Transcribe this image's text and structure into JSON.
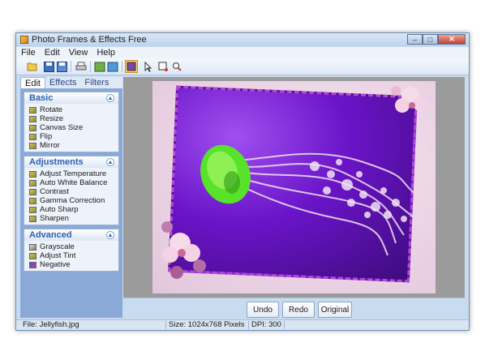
{
  "window": {
    "title": "Photo Frames & Effects Free"
  },
  "window_buttons": {
    "minimize": "–",
    "maximize": "□",
    "close": "✕"
  },
  "menu": [
    "File",
    "Edit",
    "View",
    "Help"
  ],
  "toolbar": {
    "icons": [
      "open-icon",
      "save-icon",
      "save-as-icon",
      "print-icon",
      "select-icon",
      "crop-icon",
      "frame-icon",
      "pointer-icon",
      "rectangle-icon",
      "zoom-icon"
    ]
  },
  "tabs": [
    {
      "label": "Edit",
      "active": true
    },
    {
      "label": "Effects",
      "active": false
    },
    {
      "label": "Filters",
      "active": false
    }
  ],
  "groups": [
    {
      "title": "Basic",
      "items": [
        "Rotate",
        "Resize",
        "Canvas Size",
        "Flip",
        "Mirror"
      ]
    },
    {
      "title": "Adjustments",
      "items": [
        "Adjust Temperature",
        "Auto White Balance",
        "Contrast",
        "Gamma Correction",
        "Auto Sharp",
        "Sharpen"
      ]
    },
    {
      "title": "Advanced",
      "items": [
        "Grayscale",
        "Adjust Tint",
        "Negative"
      ]
    }
  ],
  "actions": {
    "undo": "Undo",
    "redo": "Redo",
    "original": "Original"
  },
  "status": {
    "file": "File: Jellyfish.jpg",
    "size": "Size: 1024x768 Pixels",
    "dpi": "DPI: 300"
  },
  "colors": {
    "accent": "#2f5fb3",
    "frame": "#b44bd0",
    "background": "#6a14c8"
  }
}
